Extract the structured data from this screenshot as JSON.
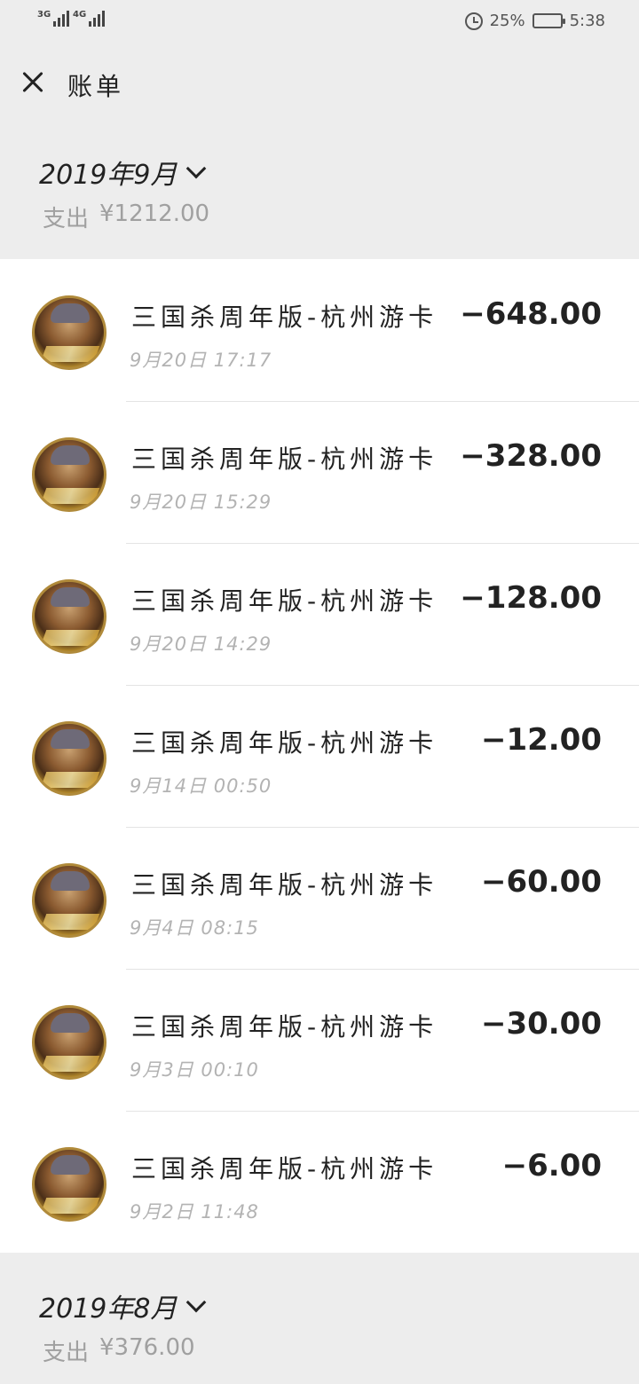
{
  "status_bar": {
    "sim1": "3G",
    "sim2": "4G",
    "battery": "25%",
    "battery_level": 0.25,
    "time": "5:38"
  },
  "header": {
    "title": "账单"
  },
  "months": [
    {
      "label": "2019年9月",
      "expense_label": "支出",
      "expense_total": "¥1212.00",
      "transactions": [
        {
          "name": "三国杀周年版-杭州游卡",
          "time": "9月20日 17:17",
          "amount": "−648.00"
        },
        {
          "name": "三国杀周年版-杭州游卡",
          "time": "9月20日 15:29",
          "amount": "−328.00"
        },
        {
          "name": "三国杀周年版-杭州游卡",
          "time": "9月20日 14:29",
          "amount": "−128.00"
        },
        {
          "name": "三国杀周年版-杭州游卡",
          "time": "9月14日 00:50",
          "amount": "−12.00"
        },
        {
          "name": "三国杀周年版-杭州游卡",
          "time": "9月4日 08:15",
          "amount": "−60.00"
        },
        {
          "name": "三国杀周年版-杭州游卡",
          "time": "9月3日 00:10",
          "amount": "−30.00"
        },
        {
          "name": "三国杀周年版-杭州游卡",
          "time": "9月2日 11:48",
          "amount": "−6.00"
        }
      ]
    },
    {
      "label": "2019年8月",
      "expense_label": "支出",
      "expense_total": "¥376.00"
    }
  ]
}
